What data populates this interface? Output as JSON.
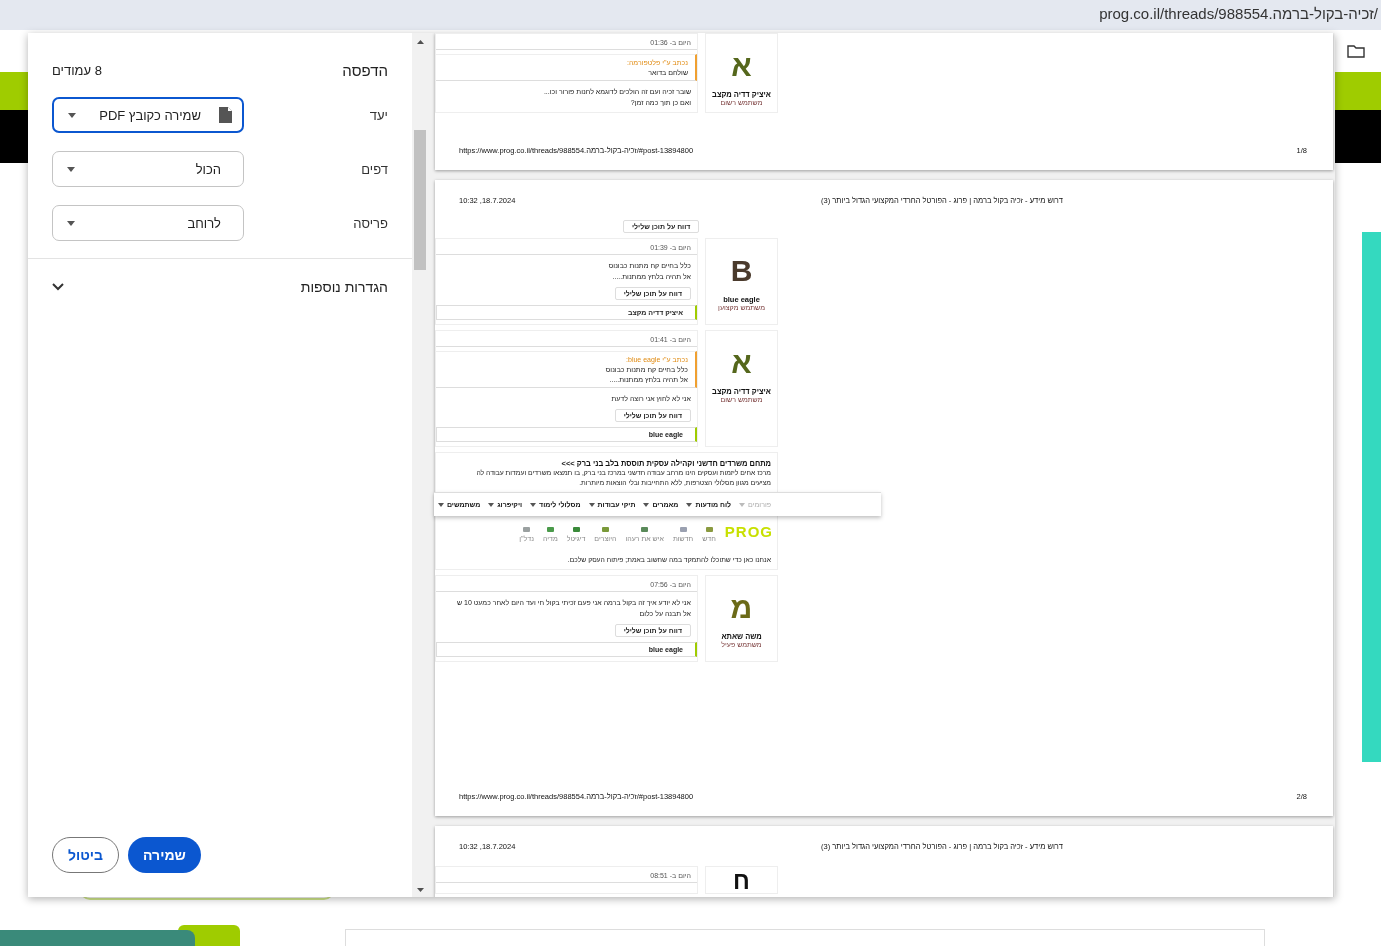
{
  "browser": {
    "url": "prog.co.il/threads/988554.זכיה-בקול-ברמה/"
  },
  "print": {
    "title": "הדפסה",
    "sheets": "8 עמודים",
    "settings": [
      {
        "label": "יעד",
        "value": "שמירה כקובץ PDF",
        "kind": "destination",
        "focused": true
      },
      {
        "label": "דפים",
        "value": "הכול",
        "kind": "select",
        "focused": false
      },
      {
        "label": "פריסה",
        "value": "לרוחב",
        "kind": "select",
        "focused": false
      }
    ],
    "more_settings": {
      "label": "הגדרות נוספות",
      "expanded": false
    },
    "buttons": [
      {
        "label": "שמירה",
        "kind": "primary"
      },
      {
        "label": "ביטול",
        "kind": "secondary"
      }
    ]
  },
  "preview": {
    "pages": [
      {
        "blocks": [
          {
            "kind": "post",
            "avatar": "א",
            "color": "#55671c",
            "name": "איציק דדיה מקצב",
            "role": "משתמש רשום",
            "time": "היום ב- 01:36",
            "quote": {
              "author": "נכתב ע\"י פלטפורמה:",
              "lines": [
                "שולחם בדואר"
              ]
            },
            "lines": [
              "שובר זכיה ועם זה הולכים לדוגמא לחנות פורור וכו...",
              "ואם כן תוך כמה זמן?"
            ]
          }
        ],
        "url": "https://www.prog.co.il/threads/988554.זכיה-בקול-ברמה/#post-13894800",
        "number": "1/8"
      },
      {
        "title": "דרוש מידע - זכיה בקול ברמה | פרוג - הפורטל החרדי המקצועי הגדול ביותר (3)",
        "date": "18.7.2024, 10:32",
        "blocks": [
          {
            "kind": "report",
            "label": "דווח על תוכן שלילי"
          },
          {
            "kind": "post",
            "avatar": "B",
            "color": "#4a3a2c",
            "name": "blue eagle",
            "role": "משתמש מקצוען",
            "time": "היום ב- 01:39",
            "lines": [
              "כלל בחיים קח מתנות כבונוס",
              "אל תהיה בלחץ ממתנות....."
            ],
            "report": "דווח על תוכן שלילי",
            "liked": "איציק דדיה מקצב"
          },
          {
            "kind": "post",
            "avatar": "א",
            "color": "#55671c",
            "name": "איציק דדיה מקצב",
            "role": "משתמש רשום",
            "time": "היום ב- 01:41",
            "quote": {
              "author": "נכתב ע\"י blue eagle:",
              "lines": [
                "כלל בחיים קח מתנות כבונוס",
                "אל תהיה בלחץ ממתנות....."
              ]
            },
            "lines": [
              "אני לא לחוץ אני רוצה לדעת"
            ],
            "report": "דווח על תוכן שלילי",
            "liked": "blue eagle"
          },
          {
            "kind": "ad",
            "title": "מתחם משרדים חדשני וקהילה עסקית תוססת בלב בני ברק >>>",
            "lines": [
              "מרכז אחים ליזמות ועסקים הינו מרחב עבודה חדשני במרכז בני ברק, בו תמצאו משרדים ועמדות עבודה לה",
              "מציעים מגוון מסלולי הצטרפות, ללא התחייבות ובלי הוצאות מיותרות."
            ],
            "menu": [
              {
                "label": "פורומים",
                "selected": true
              },
              {
                "label": "לוח מודעות",
                "selected": false
              },
              {
                "label": "מאמרים",
                "selected": false
              },
              {
                "label": "תיקי עבודות",
                "selected": false
              },
              {
                "label": "מסלולי לימוד",
                "selected": false
              },
              {
                "label": "ויקיפרוג",
                "selected": false
              },
              {
                "label": "משתמשים",
                "selected": false
              }
            ],
            "logo": "PROG",
            "shortcuts": [
              "חדש",
              "חדשות",
              "איש את רעהו",
              "היוצרים",
              "דיגיטל",
              "מדיה",
              "נדל\"ן"
            ],
            "closing": "אנחנו כאן כדי שתוכלו להתמקד במה שחשוב באמת; פיתוח העסק שלכם."
          },
          {
            "kind": "post",
            "avatar": "מ",
            "color": "#6b6a18",
            "name": "משה שאתא",
            "role": "משתמש פעיל",
            "time": "היום ב- 07:56",
            "lines": [
              "אני לא יודע איך זה בקול ברמה אני פעם זכיתי בקול חי ועד היום לאחר כמעט 10 ש",
              "אל תבנה על כלום"
            ],
            "report": "דווח על תוכן שלילי",
            "liked": "blue eagle"
          }
        ],
        "url": "https://www.prog.co.il/threads/988554.זכיה-בקול-ברמה/#post-13894800",
        "number": "2/8"
      },
      {
        "title": "דרוש מידע - זכיה בקול ברמה | פרוג - הפורטל החרדי המקצועי הגדול ביותר (3)",
        "date": "18.7.2024, 10:32",
        "blocks": [
          {
            "kind": "post",
            "avatar": "ח",
            "color": "#111111",
            "time": "היום ב- 08:51"
          }
        ]
      }
    ]
  }
}
